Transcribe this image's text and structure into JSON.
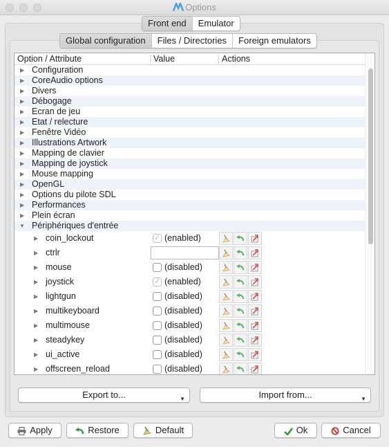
{
  "window": {
    "title": "Options"
  },
  "top_tabs": [
    {
      "label": "Front end",
      "active": true
    },
    {
      "label": "Emulator",
      "active": false
    }
  ],
  "sub_tabs": [
    {
      "label": "Global configuration",
      "active": true
    },
    {
      "label": "Files / Directories",
      "active": false
    },
    {
      "label": "Foreign emulators",
      "active": false
    }
  ],
  "tree": {
    "headers": {
      "option": "Option / Attribute",
      "value": "Value",
      "actions": "Actions"
    },
    "categories": [
      "Configuration",
      "CoreAudio options",
      "Divers",
      "Débogage",
      "Ecran de jeu",
      "Etat / relecture",
      "Fenêtre Vidéo",
      "Illustrations Artwork",
      "Mapping de clavier",
      "Mapping de joystick",
      "Mouse mapping",
      "OpenGL",
      "Options du pilote SDL",
      "Performances",
      "Plein écran"
    ],
    "expanded_category": "Périphériques d'entrée",
    "children": [
      {
        "name": "coin_lockout",
        "type": "checkbox",
        "checked": true,
        "disabled_look": true,
        "value": "(enabled)"
      },
      {
        "name": "ctrlr",
        "type": "text",
        "value": ""
      },
      {
        "name": "mouse",
        "type": "checkbox",
        "checked": false,
        "value": "(disabled)"
      },
      {
        "name": "joystick",
        "type": "checkbox",
        "checked": true,
        "disabled_look": true,
        "value": "(enabled)"
      },
      {
        "name": "lightgun",
        "type": "checkbox",
        "checked": false,
        "value": "(disabled)"
      },
      {
        "name": "multikeyboard",
        "type": "checkbox",
        "checked": false,
        "value": "(disabled)"
      },
      {
        "name": "multimouse",
        "type": "checkbox",
        "checked": false,
        "value": "(disabled)"
      },
      {
        "name": "steadykey",
        "type": "checkbox",
        "checked": false,
        "value": "(disabled)"
      },
      {
        "name": "ui_active",
        "type": "checkbox",
        "checked": false,
        "value": "(disabled)"
      },
      {
        "name": "offscreen_reload",
        "type": "checkbox",
        "checked": false,
        "value": "(disabled)"
      }
    ],
    "row_action_icons": [
      "broom-icon",
      "restore-icon",
      "revert-icon"
    ]
  },
  "export_button": "Export to...",
  "import_button": "Import from...",
  "bottom_buttons": {
    "apply": "Apply",
    "restore": "Restore",
    "default": "Default",
    "ok": "Ok",
    "cancel": "Cancel"
  },
  "colors": {
    "row_alt": "#eef3fb",
    "ok_green": "#2e9a2e",
    "cancel_red": "#d42b2b",
    "restore_green": "#2f9a3a"
  }
}
